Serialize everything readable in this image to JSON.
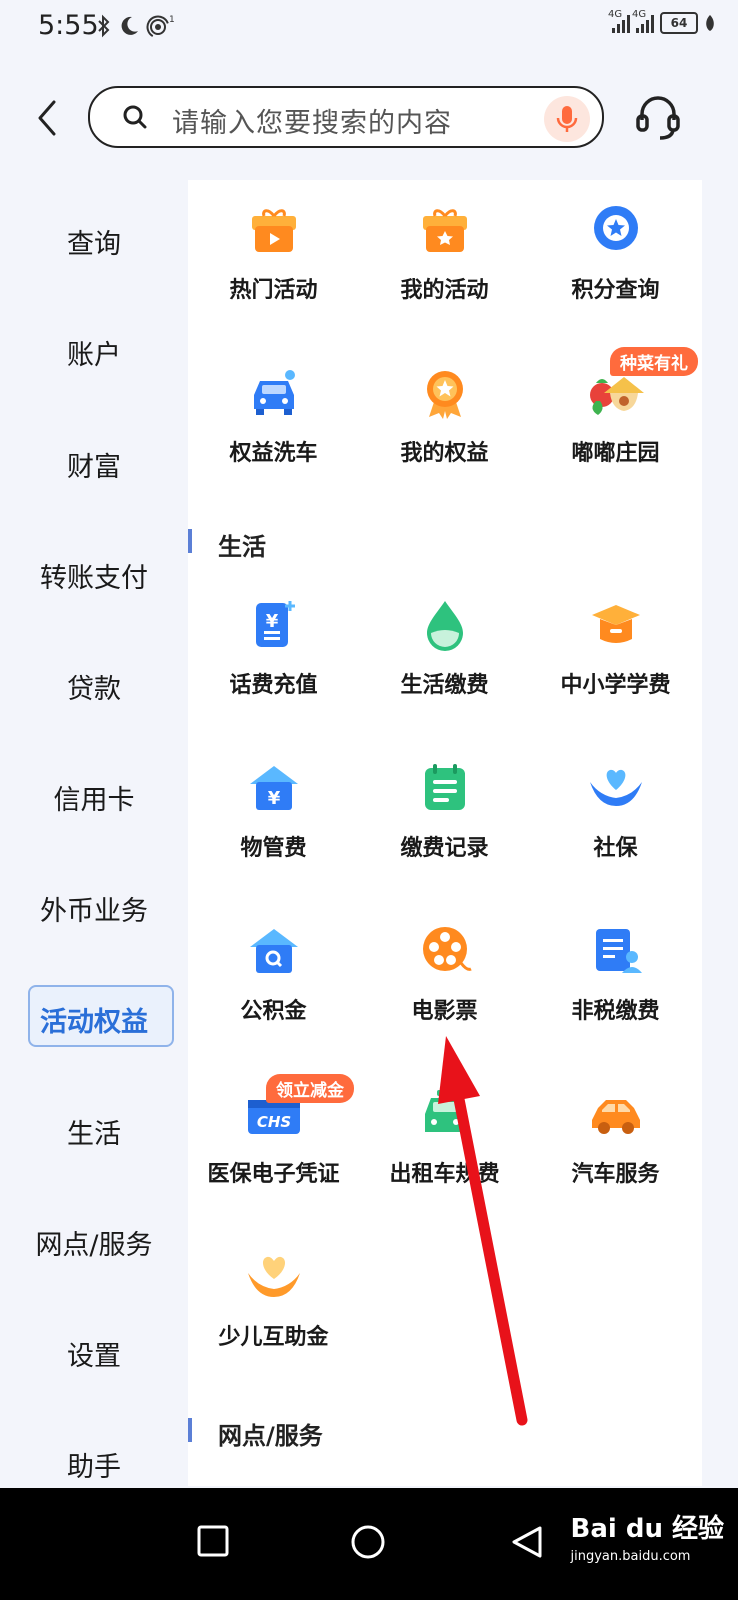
{
  "status": {
    "time": "5:55",
    "net1": "4G",
    "net2": "4G",
    "battery": "64"
  },
  "header": {
    "search_placeholder": "请输入您要搜索的内容"
  },
  "sidebar": {
    "items": [
      {
        "label": "查询"
      },
      {
        "label": "账户"
      },
      {
        "label": "财富"
      },
      {
        "label": "转账支付"
      },
      {
        "label": "贷款"
      },
      {
        "label": "信用卡"
      },
      {
        "label": "外币业务"
      },
      {
        "label": "活动权益"
      },
      {
        "label": "生活"
      },
      {
        "label": "网点/服务"
      },
      {
        "label": "设置"
      },
      {
        "label": "助手"
      }
    ],
    "active": "活动权益"
  },
  "activities": {
    "items": [
      {
        "label": "热门活动",
        "icon": "gift-play-icon"
      },
      {
        "label": "我的活动",
        "icon": "gift-star-icon"
      },
      {
        "label": "积分查询",
        "icon": "star-badge-icon"
      },
      {
        "label": "权益洗车",
        "icon": "car-wash-icon"
      },
      {
        "label": "我的权益",
        "icon": "medal-icon"
      },
      {
        "label": "嘟嘟庄园",
        "icon": "farm-icon",
        "badge": "种菜有礼"
      }
    ]
  },
  "life": {
    "title": "生活",
    "items": [
      {
        "label": "话费充值",
        "icon": "phone-topup-icon"
      },
      {
        "label": "生活缴费",
        "icon": "water-drop-icon"
      },
      {
        "label": "中小学学费",
        "icon": "graduation-cap-icon"
      },
      {
        "label": "物管费",
        "icon": "house-yuan-icon"
      },
      {
        "label": "缴费记录",
        "icon": "notebook-icon"
      },
      {
        "label": "社保",
        "icon": "hands-heart-icon"
      },
      {
        "label": "公积金",
        "icon": "house-search-icon"
      },
      {
        "label": "电影票",
        "icon": "film-reel-icon"
      },
      {
        "label": "非税缴费",
        "icon": "document-person-icon"
      },
      {
        "label": "医保电子凭证",
        "icon": "chs-card-icon",
        "badge": "领立减金",
        "card_text": "CHS"
      },
      {
        "label": "出租车规费",
        "icon": "taxi-icon"
      },
      {
        "label": "汽车服务",
        "icon": "car-icon"
      },
      {
        "label": "少儿互助金",
        "icon": "child-hands-icon"
      }
    ]
  },
  "service": {
    "title": "网点/服务"
  },
  "watermark": {
    "brand": "Bai du 经验",
    "url": "jingyan.baidu.com"
  },
  "colors": {
    "accent_blue": "#2a6fd8",
    "orange": "#ff8a2a",
    "green": "#2ec27e",
    "annotation_red": "#e8121a"
  }
}
